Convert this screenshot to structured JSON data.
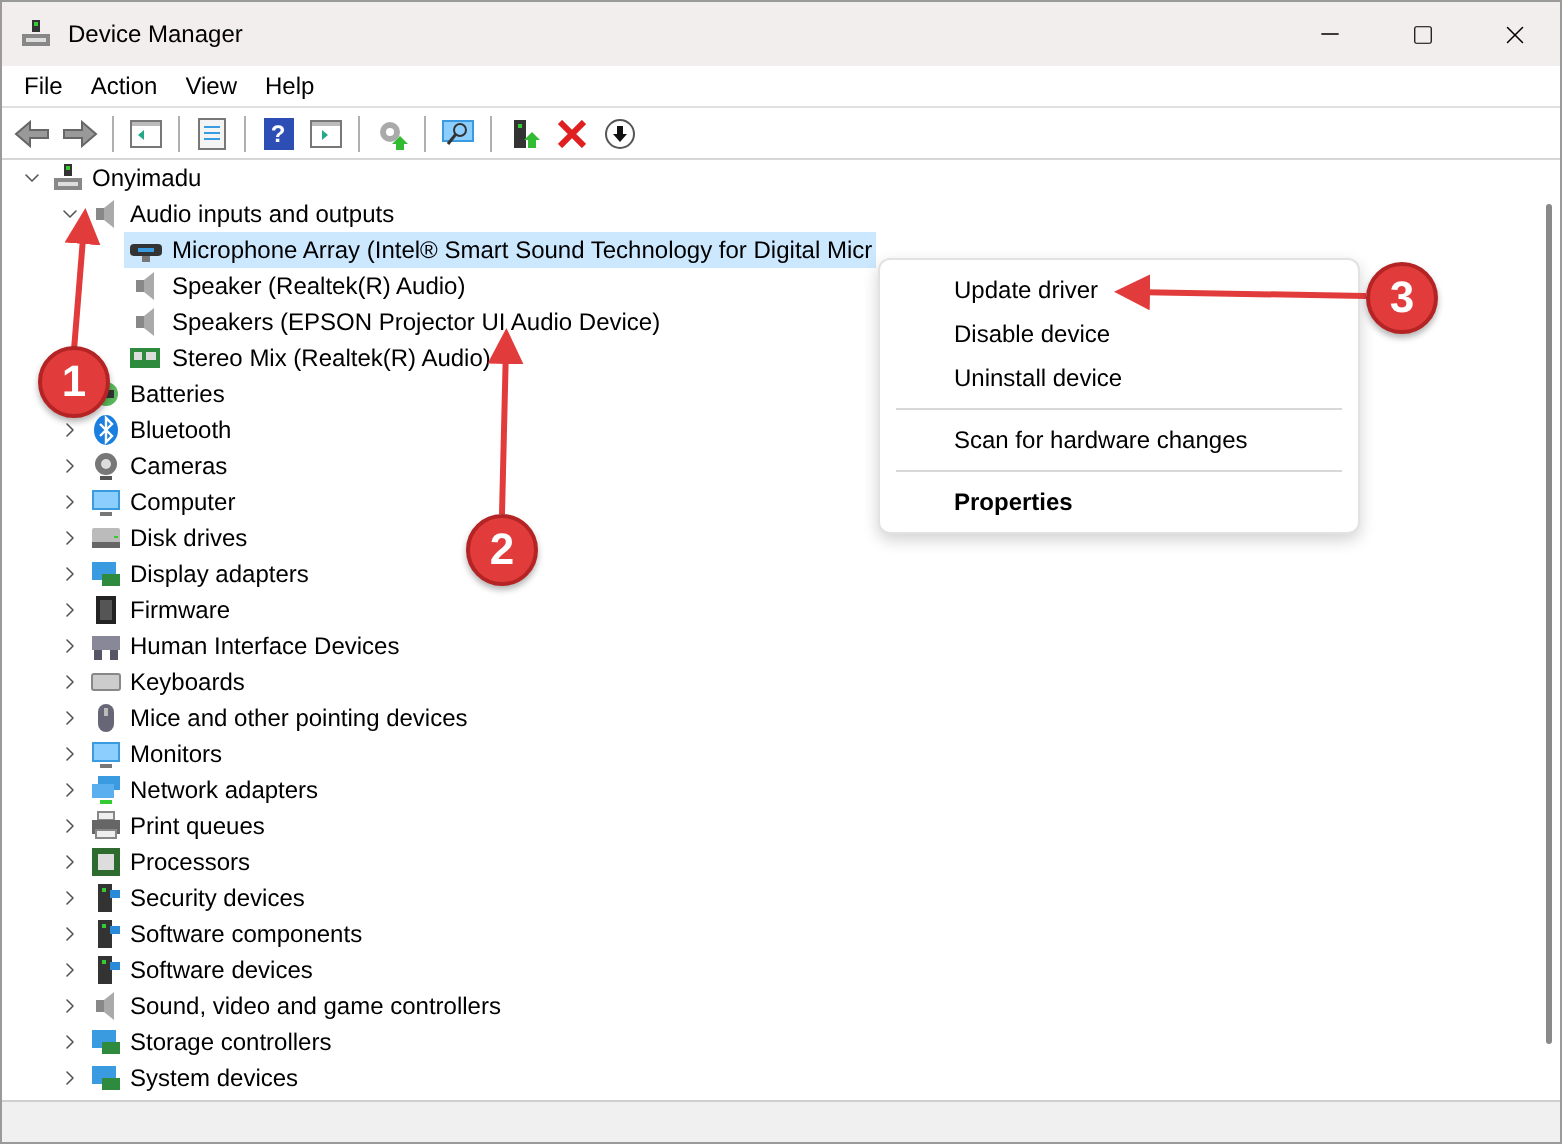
{
  "window": {
    "title": "Device Manager"
  },
  "menu": [
    "File",
    "Action",
    "View",
    "Help"
  ],
  "toolbar": {
    "help_glyph": "?"
  },
  "tree": {
    "label": "Onyimadu",
    "expanded": true,
    "selected": false,
    "children": [
      {
        "label": "Audio inputs and outputs",
        "expanded": true,
        "selected": false,
        "children": [
          {
            "label": "Microphone Array (Intel® Smart Sound Technology for Digital Micr",
            "selected": true
          },
          {
            "label": "Speaker (Realtek(R) Audio)",
            "selected": false
          },
          {
            "label": "Speakers (EPSON Projector UI Audio Device)",
            "selected": false
          },
          {
            "label": "Stereo Mix (Realtek(R) Audio)",
            "selected": false
          }
        ]
      },
      {
        "label": "Batteries",
        "selected": false
      },
      {
        "label": "Bluetooth",
        "expanded": false,
        "selected": false
      },
      {
        "label": "Cameras",
        "expanded": false,
        "selected": false
      },
      {
        "label": "Computer",
        "expanded": false,
        "selected": false
      },
      {
        "label": "Disk drives",
        "expanded": false,
        "selected": false
      },
      {
        "label": "Display adapters",
        "expanded": false,
        "selected": false
      },
      {
        "label": "Firmware",
        "expanded": false,
        "selected": false
      },
      {
        "label": "Human Interface Devices",
        "expanded": false,
        "selected": false
      },
      {
        "label": "Keyboards",
        "expanded": false,
        "selected": false
      },
      {
        "label": "Mice and other pointing devices",
        "expanded": false,
        "selected": false
      },
      {
        "label": "Monitors",
        "expanded": false,
        "selected": false
      },
      {
        "label": "Network adapters",
        "expanded": false,
        "selected": false
      },
      {
        "label": "Print queues",
        "expanded": false,
        "selected": false
      },
      {
        "label": "Processors",
        "expanded": false,
        "selected": false
      },
      {
        "label": "Security devices",
        "expanded": false,
        "selected": false
      },
      {
        "label": "Software components",
        "expanded": false,
        "selected": false
      },
      {
        "label": "Software devices",
        "expanded": false,
        "selected": false
      },
      {
        "label": "Sound, video and game controllers",
        "expanded": false,
        "selected": false
      },
      {
        "label": "Storage controllers",
        "expanded": false,
        "selected": false
      },
      {
        "label": "System devices",
        "expanded": false,
        "selected": false
      }
    ]
  },
  "context_menu": {
    "groups": [
      [
        {
          "label": "Update driver",
          "default": false
        },
        {
          "label": "Disable device",
          "default": false
        },
        {
          "label": "Uninstall device",
          "default": false
        }
      ],
      [
        {
          "label": "Scan for hardware changes",
          "default": false
        }
      ],
      [
        {
          "label": "Properties",
          "default": true
        }
      ]
    ]
  },
  "callouts": [
    {
      "number": "1"
    },
    {
      "number": "2"
    },
    {
      "number": "3"
    }
  ]
}
